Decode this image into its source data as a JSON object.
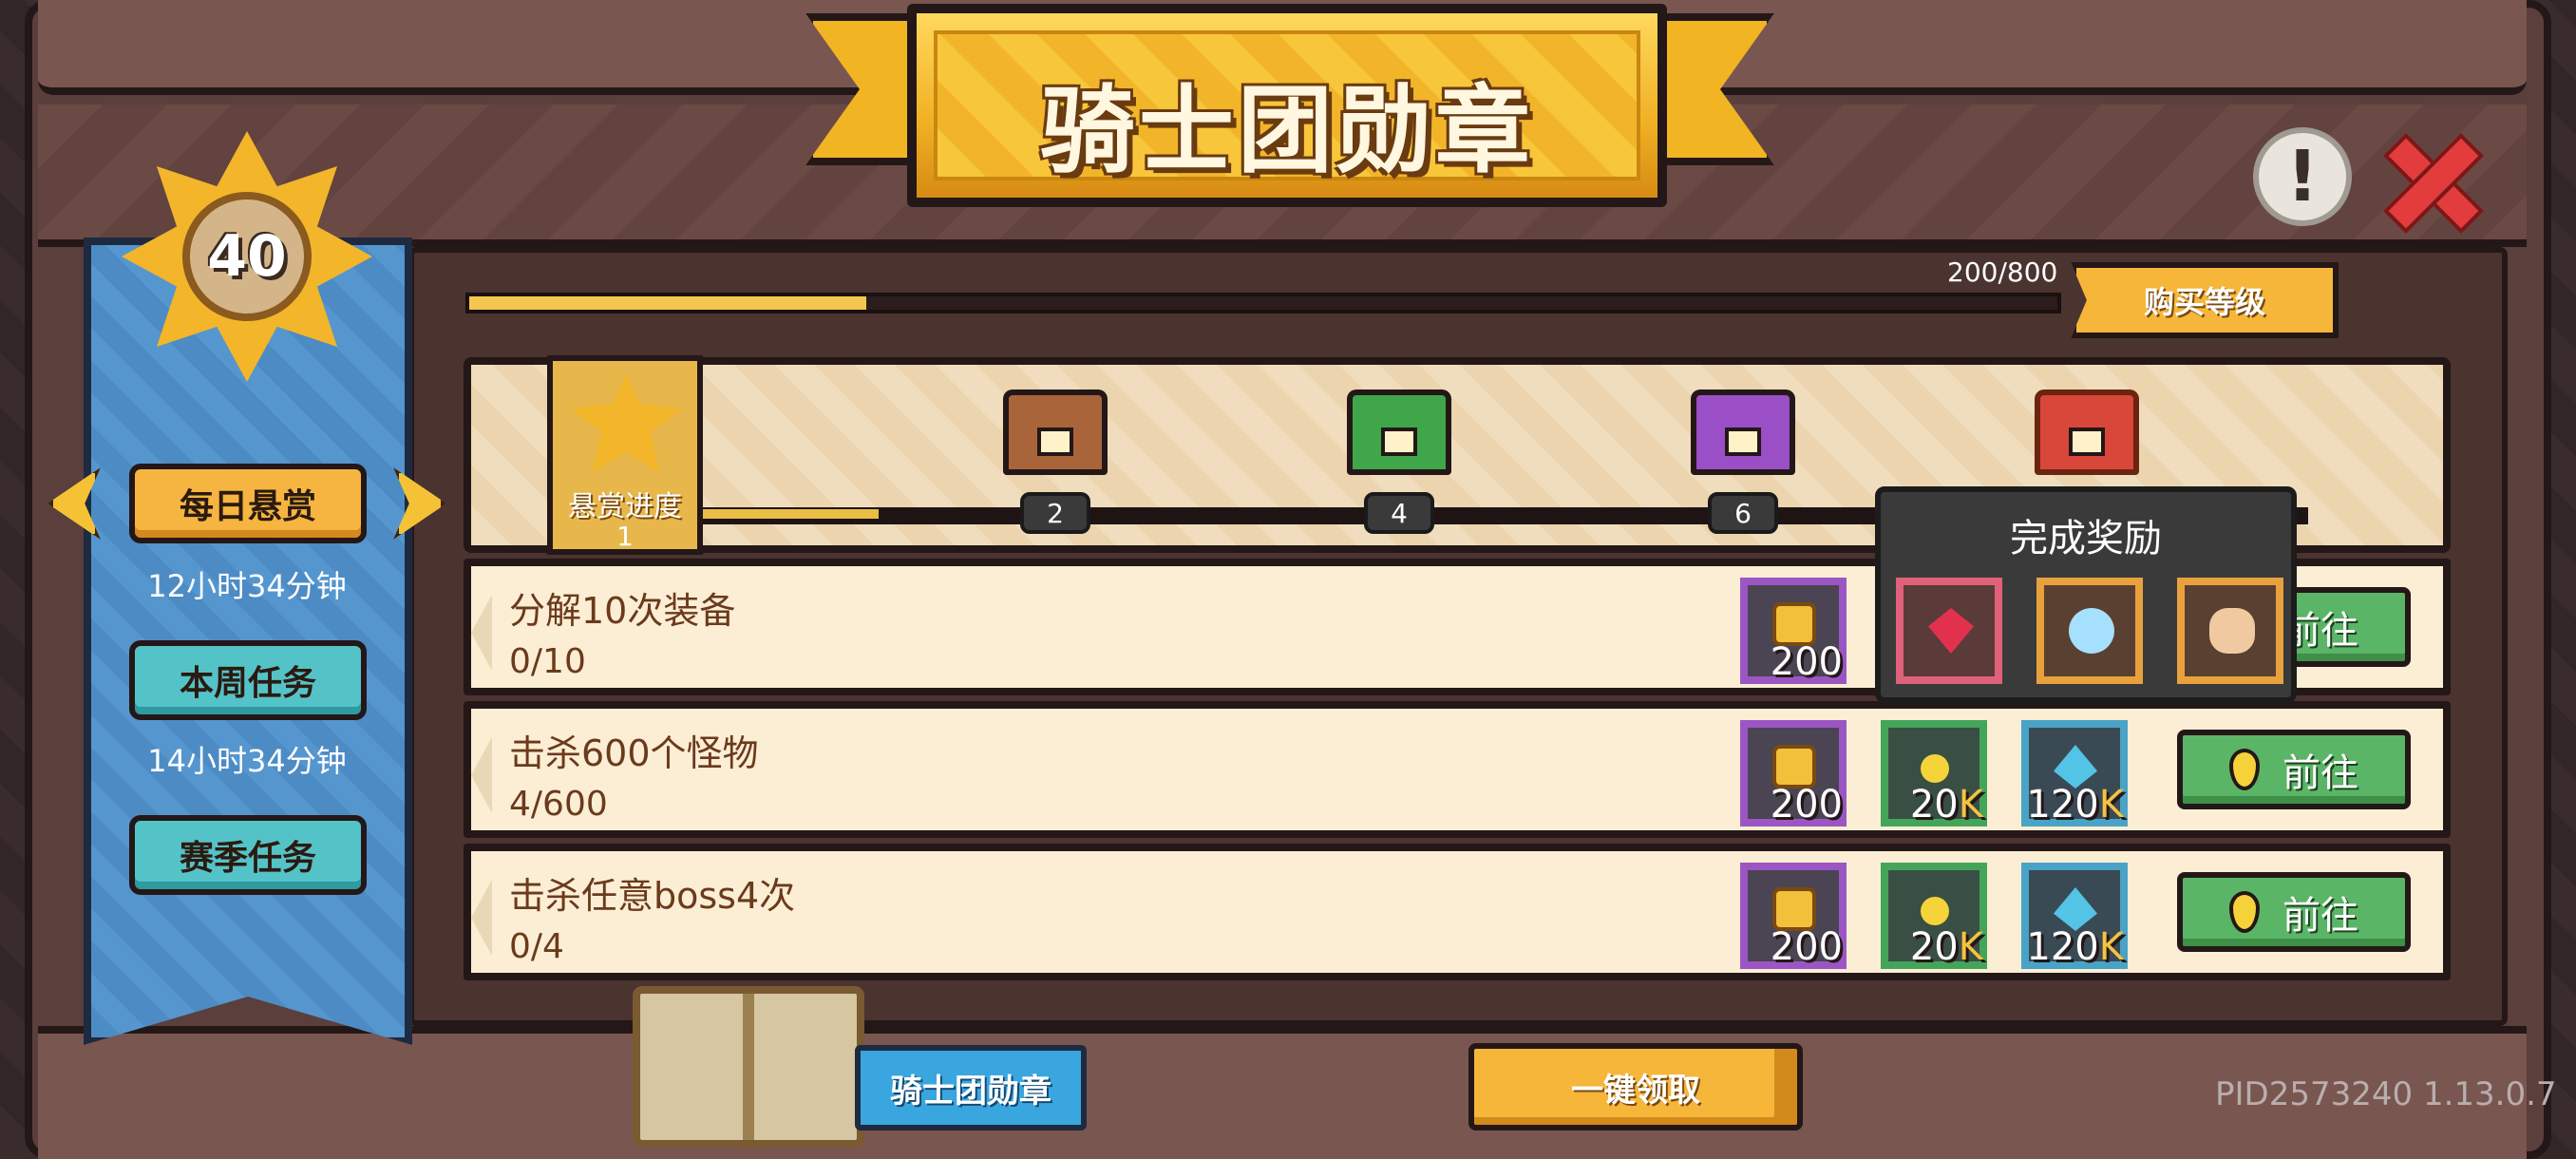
{
  "header": {
    "title": "骑士团勋章"
  },
  "level": {
    "value": "40"
  },
  "sidebar": {
    "tabs": [
      {
        "label": "每日悬赏",
        "timer": "12小时34分钟"
      },
      {
        "label": "本周任务",
        "timer": "14小时34分钟"
      },
      {
        "label": "赛季任务"
      }
    ]
  },
  "progress": {
    "text": "200/800",
    "fraction": 0.25,
    "buy_label": "购买等级"
  },
  "milestones": {
    "progress_label": "悬赏进度",
    "progress_value": "1",
    "fill_fraction": 0.12,
    "chests": [
      {
        "name": "brown-chest",
        "badge": "2"
      },
      {
        "name": "green-chest",
        "badge": "4"
      },
      {
        "name": "purple-chest",
        "badge": "6"
      },
      {
        "name": "red-chest",
        "badge": ""
      }
    ]
  },
  "popup": {
    "title": "完成奖励",
    "items": [
      "ruby-icon",
      "rainbow-gem-icon",
      "flower-charm-icon"
    ]
  },
  "tasks": [
    {
      "title": "分解10次装备",
      "progress": "0/10",
      "rewards": [
        {
          "type": "medal",
          "amount": "200"
        }
      ],
      "go_label": "前往"
    },
    {
      "title": "击杀600个怪物",
      "progress": "4/600",
      "rewards": [
        {
          "type": "medal",
          "amount": "200"
        },
        {
          "type": "coin",
          "amount": "20",
          "unit": "K"
        },
        {
          "type": "exp",
          "amount": "120",
          "unit": "K"
        }
      ],
      "go_label": "前往"
    },
    {
      "title": "击杀任意boss4次",
      "progress": "0/4",
      "rewards": [
        {
          "type": "medal",
          "amount": "200"
        },
        {
          "type": "coin",
          "amount": "20",
          "unit": "K"
        },
        {
          "type": "exp",
          "amount": "120",
          "unit": "K"
        }
      ],
      "go_label": "前往"
    }
  ],
  "footer": {
    "book_label": "骑士团勋章",
    "claim_all_label": "一键领取",
    "version": "PID2573240 1.13.0.7"
  },
  "colors": {
    "accent_gold": "#f6b63a",
    "go_green": "#5bb567",
    "ribbon_blue": "#4d8bc4"
  }
}
